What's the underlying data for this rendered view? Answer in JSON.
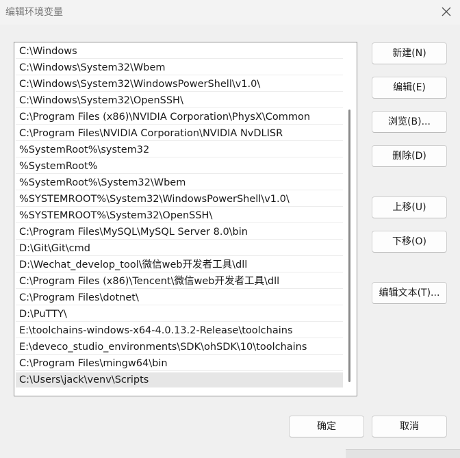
{
  "window": {
    "title": "编辑环境变量",
    "close_icon": "close-icon"
  },
  "paths": [
    "C:\\Windows",
    "C:\\Windows\\System32\\Wbem",
    "C:\\Windows\\System32\\WindowsPowerShell\\v1.0\\",
    "C:\\Windows\\System32\\OpenSSH\\",
    "C:\\Program Files (x86)\\NVIDIA Corporation\\PhysX\\Common",
    "C:\\Program Files\\NVIDIA Corporation\\NVIDIA NvDLISR",
    "%SystemRoot%\\system32",
    "%SystemRoot%",
    "%SystemRoot%\\System32\\Wbem",
    "%SYSTEMROOT%\\System32\\WindowsPowerShell\\v1.0\\",
    "%SYSTEMROOT%\\System32\\OpenSSH\\",
    "C:\\Program Files\\MySQL\\MySQL Server 8.0\\bin",
    "D:\\Git\\Git\\cmd",
    "D:\\Wechat_develop_tool\\微信web开发者工具\\dll",
    "C:\\Program Files (x86)\\Tencent\\微信web开发者工具\\dll",
    "C:\\Program Files\\dotnet\\",
    "D:\\PuTTY\\",
    "E:\\toolchains-windows-x64-4.0.13.2-Release\\toolchains",
    "E:\\deveco_studio_environments\\SDK\\ohSDK\\10\\toolchains",
    "C:\\Program Files\\mingw64\\bin",
    "C:\\Users\\jack\\venv\\Scripts"
  ],
  "selected_index": 20,
  "buttons": {
    "new": "新建(N)",
    "edit": "编辑(E)",
    "browse": "浏览(B)...",
    "delete": "删除(D)",
    "move_up": "上移(U)",
    "move_down": "下移(O)",
    "edit_text": "编辑文本(T)...",
    "ok": "确定",
    "cancel": "取消"
  }
}
